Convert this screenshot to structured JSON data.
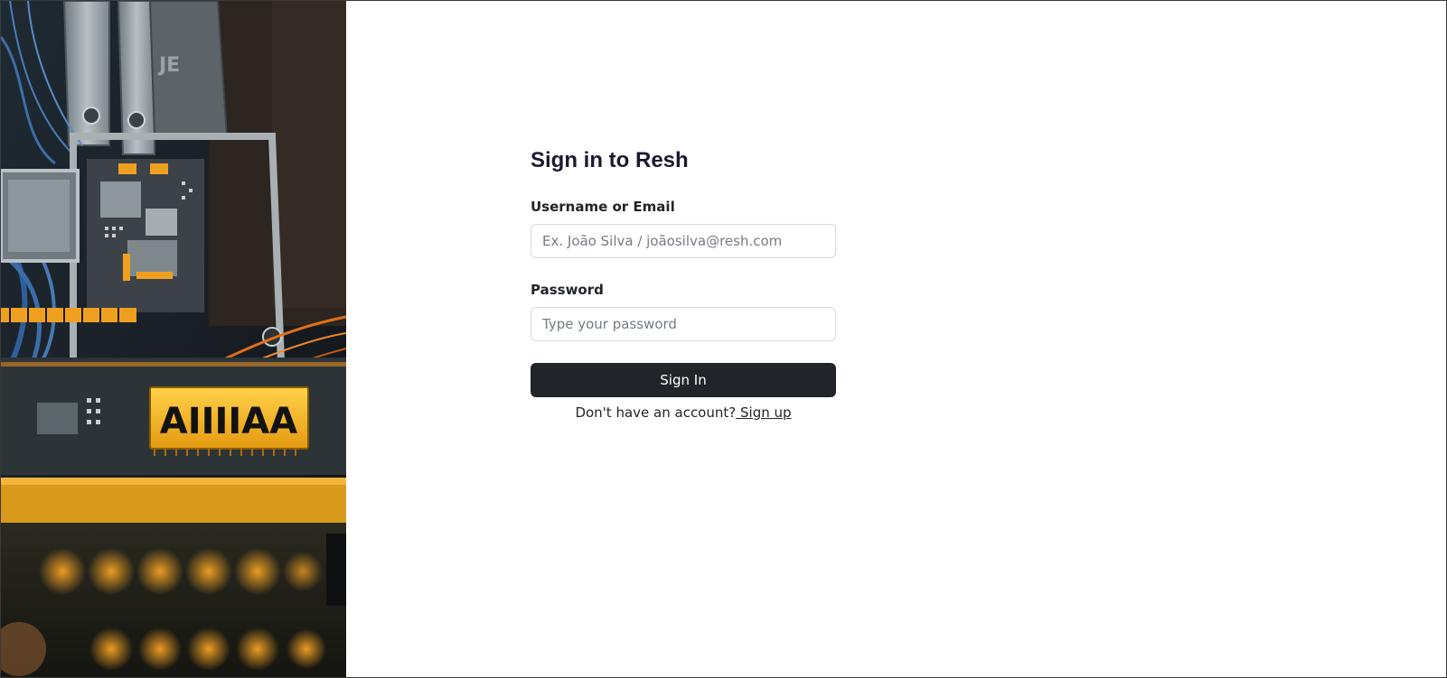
{
  "hero": {
    "image_icon": "circuit-board-image",
    "chip_text": "AIIIIAA"
  },
  "signin": {
    "title": "Sign in to Resh",
    "username_label": "Username or Email",
    "username_placeholder": "Ex. João Silva / joãosilva@resh.com",
    "username_value": "",
    "password_label": "Password",
    "password_placeholder": "Type your password",
    "password_value": "",
    "submit_label": "Sign In",
    "no_account_text": "Don't have an account?",
    "signup_link": " Sign up"
  },
  "colors": {
    "button_bg": "#212529",
    "text": "#212529",
    "accent_orange": "#f0a020"
  }
}
